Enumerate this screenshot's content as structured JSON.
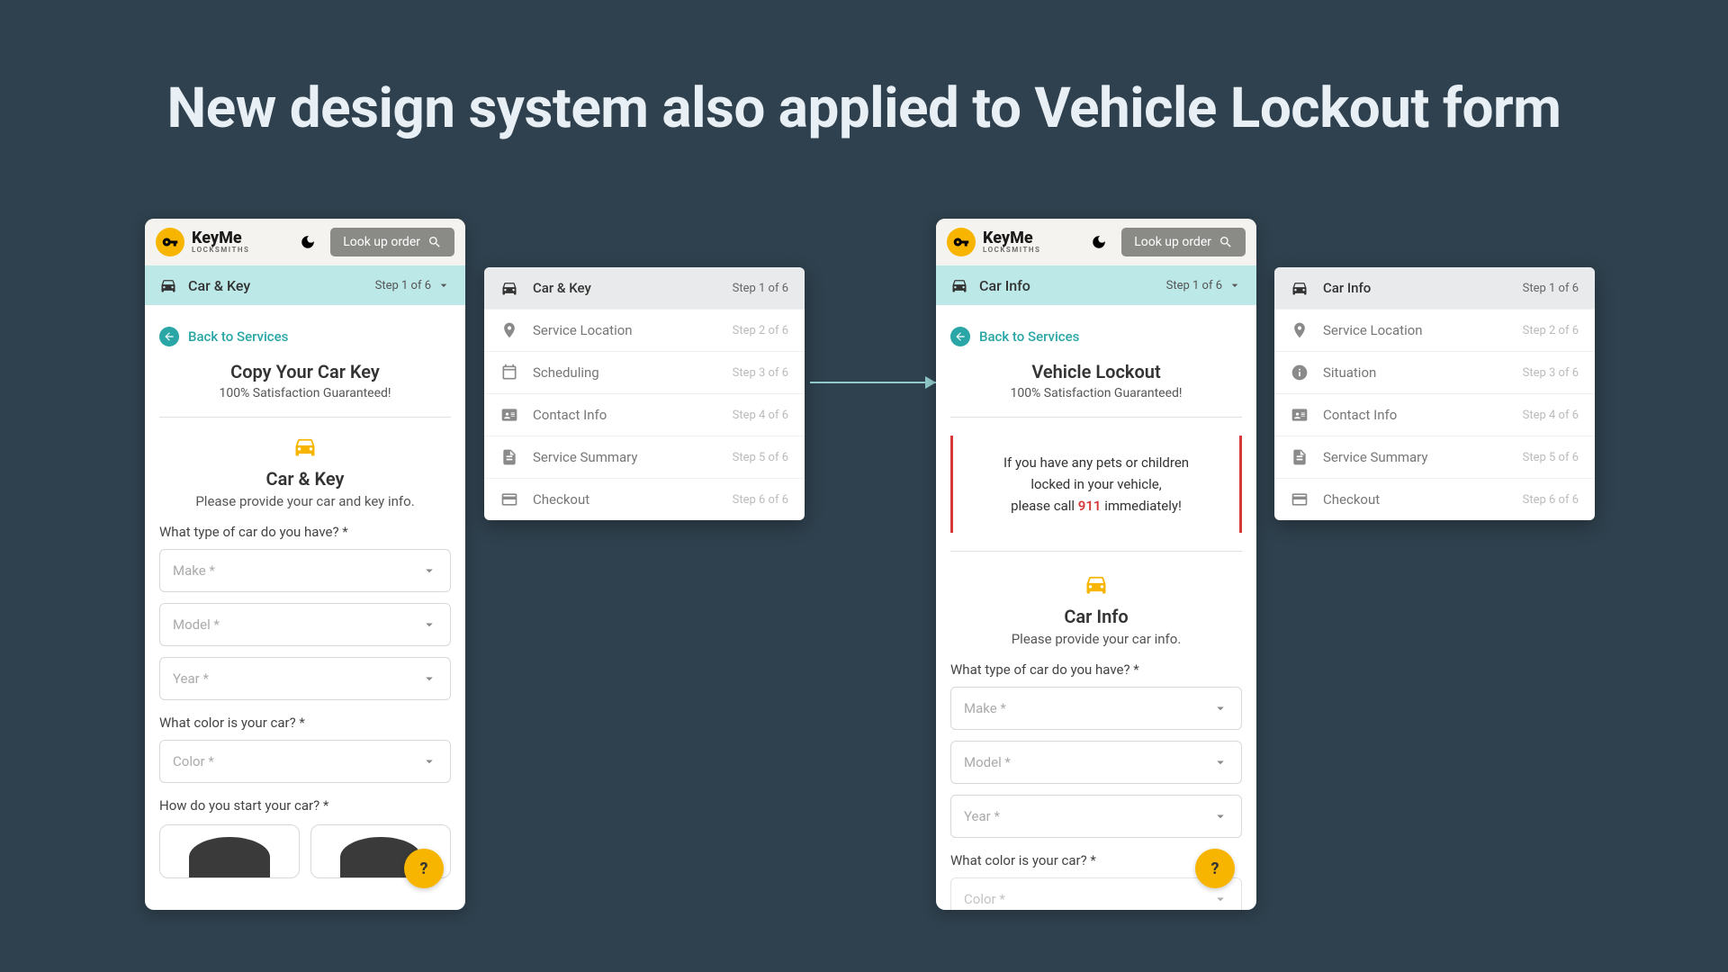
{
  "slide_title": "New design system also applied to Vehicle Lockout form",
  "logo_name": "KeyMe",
  "logo_sub": "LOCKSMITHS",
  "lookup_label": "Look up order",
  "back_label": "Back to Services",
  "left": {
    "step_label": "Car & Key",
    "step_count": "Step 1 of 6",
    "title": "Copy Your Car Key",
    "subtitle": "100% Satisfaction Guaranteed!",
    "section_title": "Car & Key",
    "section_desc": "Please provide your car and key info.",
    "q1": "What type of car do you have? *",
    "q2": "What color is your car? *",
    "q3": "How do you start your car? *",
    "make": "Make *",
    "model": "Model *",
    "year": "Year *",
    "color": "Color *",
    "steps": [
      {
        "label": "Car & Key",
        "count": "Step 1 of 6",
        "icon": "car",
        "active": true
      },
      {
        "label": "Service Location",
        "count": "Step 2 of 6",
        "icon": "pin"
      },
      {
        "label": "Scheduling",
        "count": "Step 3 of 6",
        "icon": "cal"
      },
      {
        "label": "Contact Info",
        "count": "Step 4 of 6",
        "icon": "id"
      },
      {
        "label": "Service Summary",
        "count": "Step 5 of 6",
        "icon": "doc"
      },
      {
        "label": "Checkout",
        "count": "Step 6 of 6",
        "icon": "card"
      }
    ]
  },
  "right": {
    "step_label": "Car Info",
    "step_count": "Step 1 of 6",
    "title": "Vehicle Lockout",
    "subtitle": "100% Satisfaction Guaranteed!",
    "alert_l1": "If you have any pets or children",
    "alert_l2": "locked in your vehicle,",
    "alert_l3a": "please call ",
    "alert_911": "911",
    "alert_l3b": " immediately!",
    "section_title": "Car Info",
    "section_desc": "Please provide your car info.",
    "q1": "What type of car do you have? *",
    "q2": "What color is your car? *",
    "make": "Make *",
    "model": "Model *",
    "year": "Year *",
    "color": "Color *",
    "steps": [
      {
        "label": "Car Info",
        "count": "Step 1 of 6",
        "icon": "car",
        "active": true
      },
      {
        "label": "Service Location",
        "count": "Step 2 of 6",
        "icon": "pin"
      },
      {
        "label": "Situation",
        "count": "Step 3 of 6",
        "icon": "info"
      },
      {
        "label": "Contact Info",
        "count": "Step 4 of 6",
        "icon": "id"
      },
      {
        "label": "Service Summary",
        "count": "Step 5 of 6",
        "icon": "doc"
      },
      {
        "label": "Checkout",
        "count": "Step 6 of 6",
        "icon": "card"
      }
    ]
  }
}
